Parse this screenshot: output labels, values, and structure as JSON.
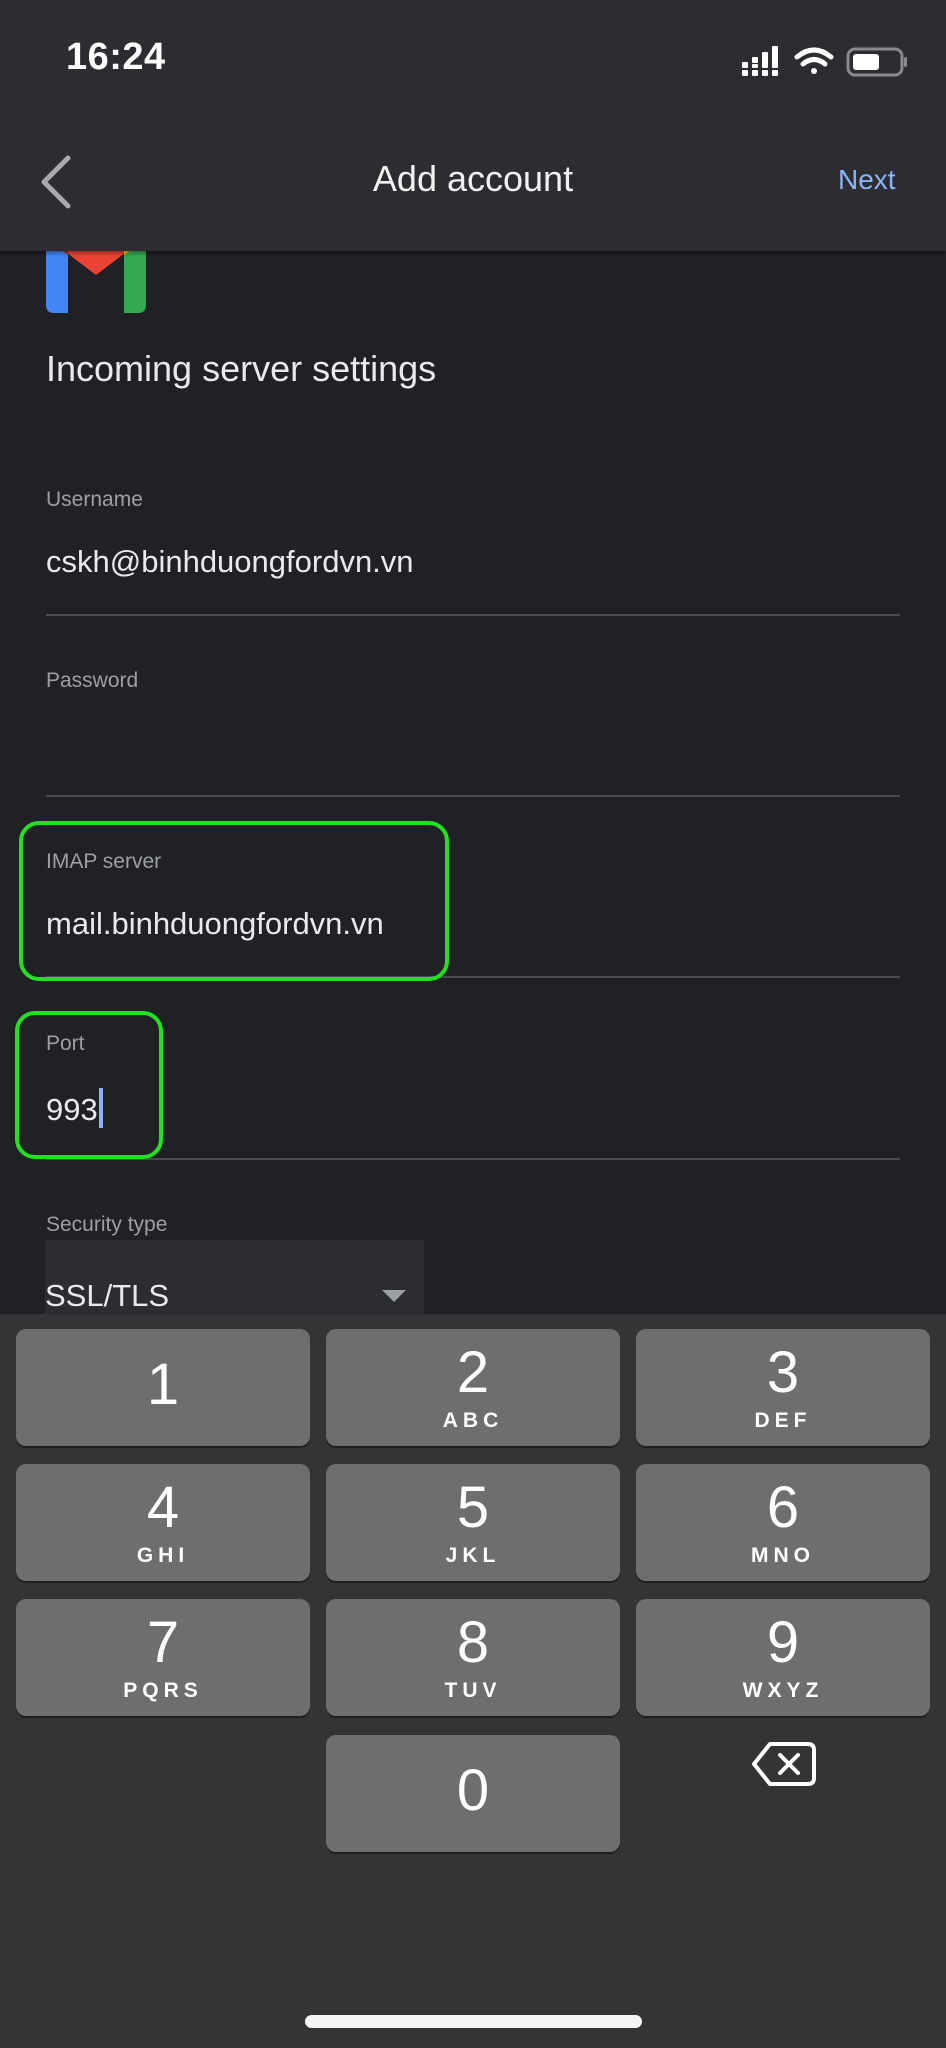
{
  "status_bar": {
    "time": "16:24",
    "icons": [
      "signal-icon",
      "wifi-icon",
      "battery-icon"
    ],
    "battery_level_percent": 55
  },
  "header": {
    "back_icon": "chevron-left-icon",
    "title": "Add account",
    "next_label": "Next"
  },
  "logo": "gmail-logo",
  "section_title": "Incoming server settings",
  "form": {
    "username": {
      "label": "Username",
      "value": "cskh@binhduongfordvn.vn"
    },
    "password": {
      "label": "Password",
      "value": ""
    },
    "imap_server": {
      "label": "IMAP server",
      "value": "mail.binhduongfordvn.vn",
      "highlighted": true
    },
    "port": {
      "label": "Port",
      "value": "993",
      "highlighted": true,
      "focused": true
    },
    "security_type": {
      "label": "Security type",
      "value": "SSL/TLS"
    }
  },
  "colors": {
    "accent": "#8ab4f8",
    "highlight": "#22e022",
    "background": "#202124",
    "header": "#2d2c31",
    "keyboard": "#333436",
    "key": "#6d6e70"
  },
  "keyboard": {
    "keys": [
      {
        "digit": "1",
        "letters": ""
      },
      {
        "digit": "2",
        "letters": "ABC"
      },
      {
        "digit": "3",
        "letters": "DEF"
      },
      {
        "digit": "4",
        "letters": "GHI"
      },
      {
        "digit": "5",
        "letters": "JKL"
      },
      {
        "digit": "6",
        "letters": "MNO"
      },
      {
        "digit": "7",
        "letters": "PQRS"
      },
      {
        "digit": "8",
        "letters": "TUV"
      },
      {
        "digit": "9",
        "letters": "WXYZ"
      },
      {
        "digit": "0",
        "letters": ""
      }
    ],
    "delete_icon": "backspace-icon"
  }
}
